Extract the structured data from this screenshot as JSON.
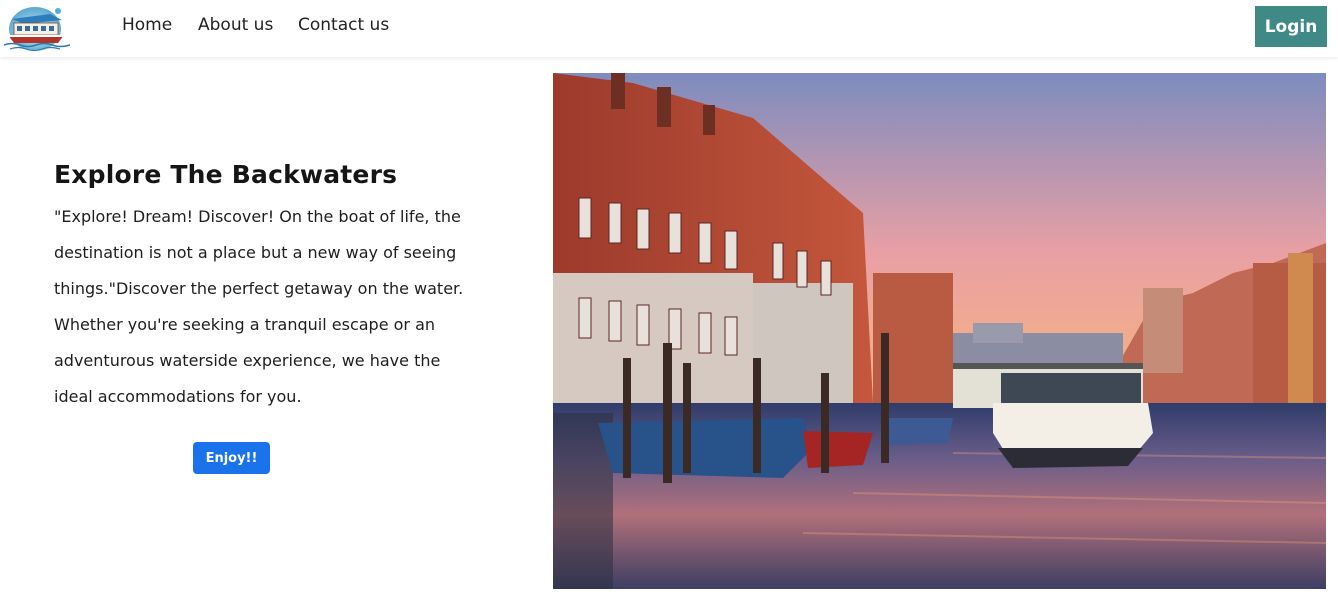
{
  "nav": {
    "links": [
      "Home",
      "About us",
      "Contact us"
    ],
    "login_label": "Login"
  },
  "brand": {
    "logo_icon": "houseboat-logo-icon"
  },
  "hero": {
    "title": "Explore The Backwaters",
    "body": "\"Explore! Dream! Discover! On the boat of life, the destination is not a place but a new way of seeing things.\"Discover the perfect getaway on the water. Whether you're seeking a tranquil escape or an adventurous waterside experience, we have the ideal accommodations for you.",
    "cta_label": "Enjoy!!",
    "image": "venice-canal-sunset-photo"
  },
  "colors": {
    "login_bg": "#3f8a87",
    "cta_bg": "#1a73ea"
  }
}
